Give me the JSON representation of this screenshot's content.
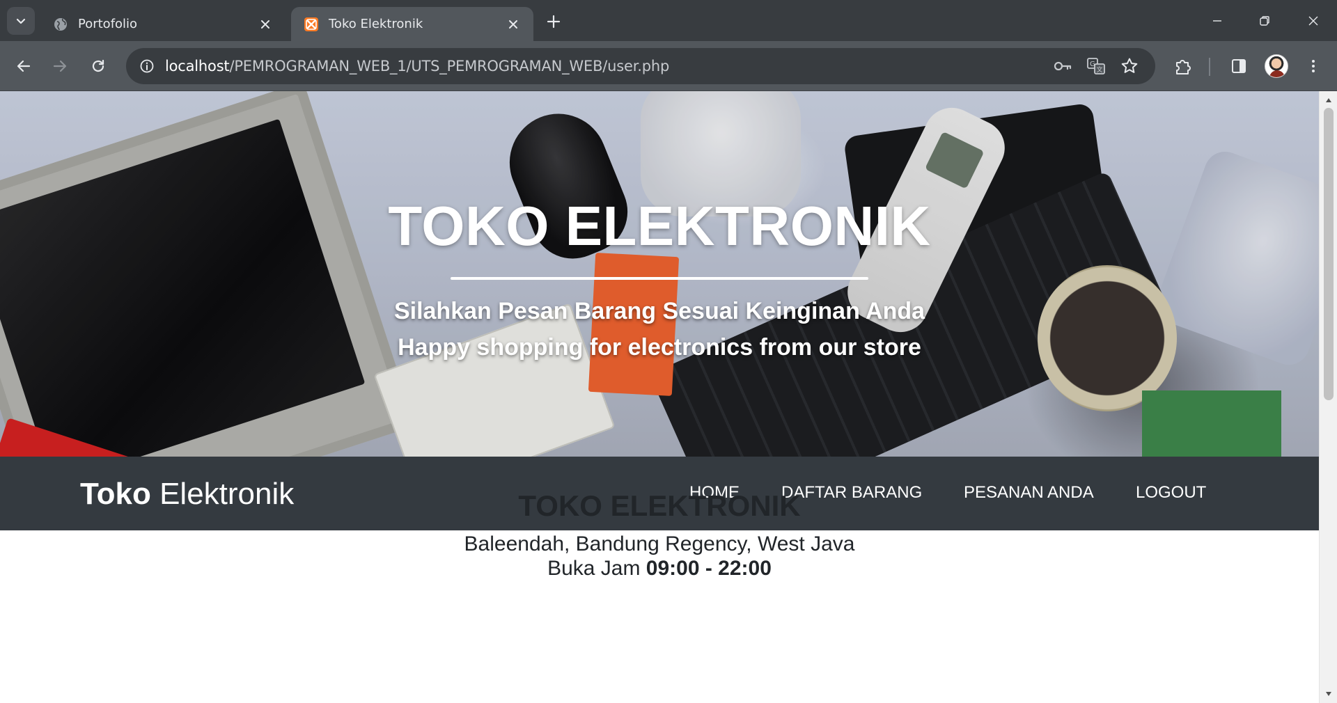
{
  "browser": {
    "tabs": [
      {
        "title": "Portofolio",
        "active": false
      },
      {
        "title": "Toko Elektronik",
        "active": true
      }
    ],
    "url": {
      "host": "localhost",
      "path": "/PEMROGRAMAN_WEB_1/UTS_PEMROGRAMAN_WEB/user.php"
    },
    "theme": {
      "frame": "#383c40",
      "toolbar": "#52575c",
      "omnibox": "#383c40",
      "text": "#e8eaed"
    }
  },
  "hero": {
    "title": "TOKO ELEKTRONIK",
    "subtitle_line1": "Silahkan Pesan Barang Sesuai Keinginan Anda",
    "subtitle_line2": "Happy shopping for electronics from our store"
  },
  "navbar": {
    "brand_bold": "Toko",
    "brand_rest": "Elektronik",
    "links": [
      "HOME",
      "DAFTAR BARANG",
      "PESANAN ANDA",
      "LOGOUT"
    ],
    "background": "#343a40"
  },
  "store_info": {
    "title": "TOKO ELEKTRONIK",
    "address": "Baleendah, Bandung Regency, West Java",
    "hours_label": "Buka Jam",
    "hours_value": "09:00 - 22:00"
  }
}
